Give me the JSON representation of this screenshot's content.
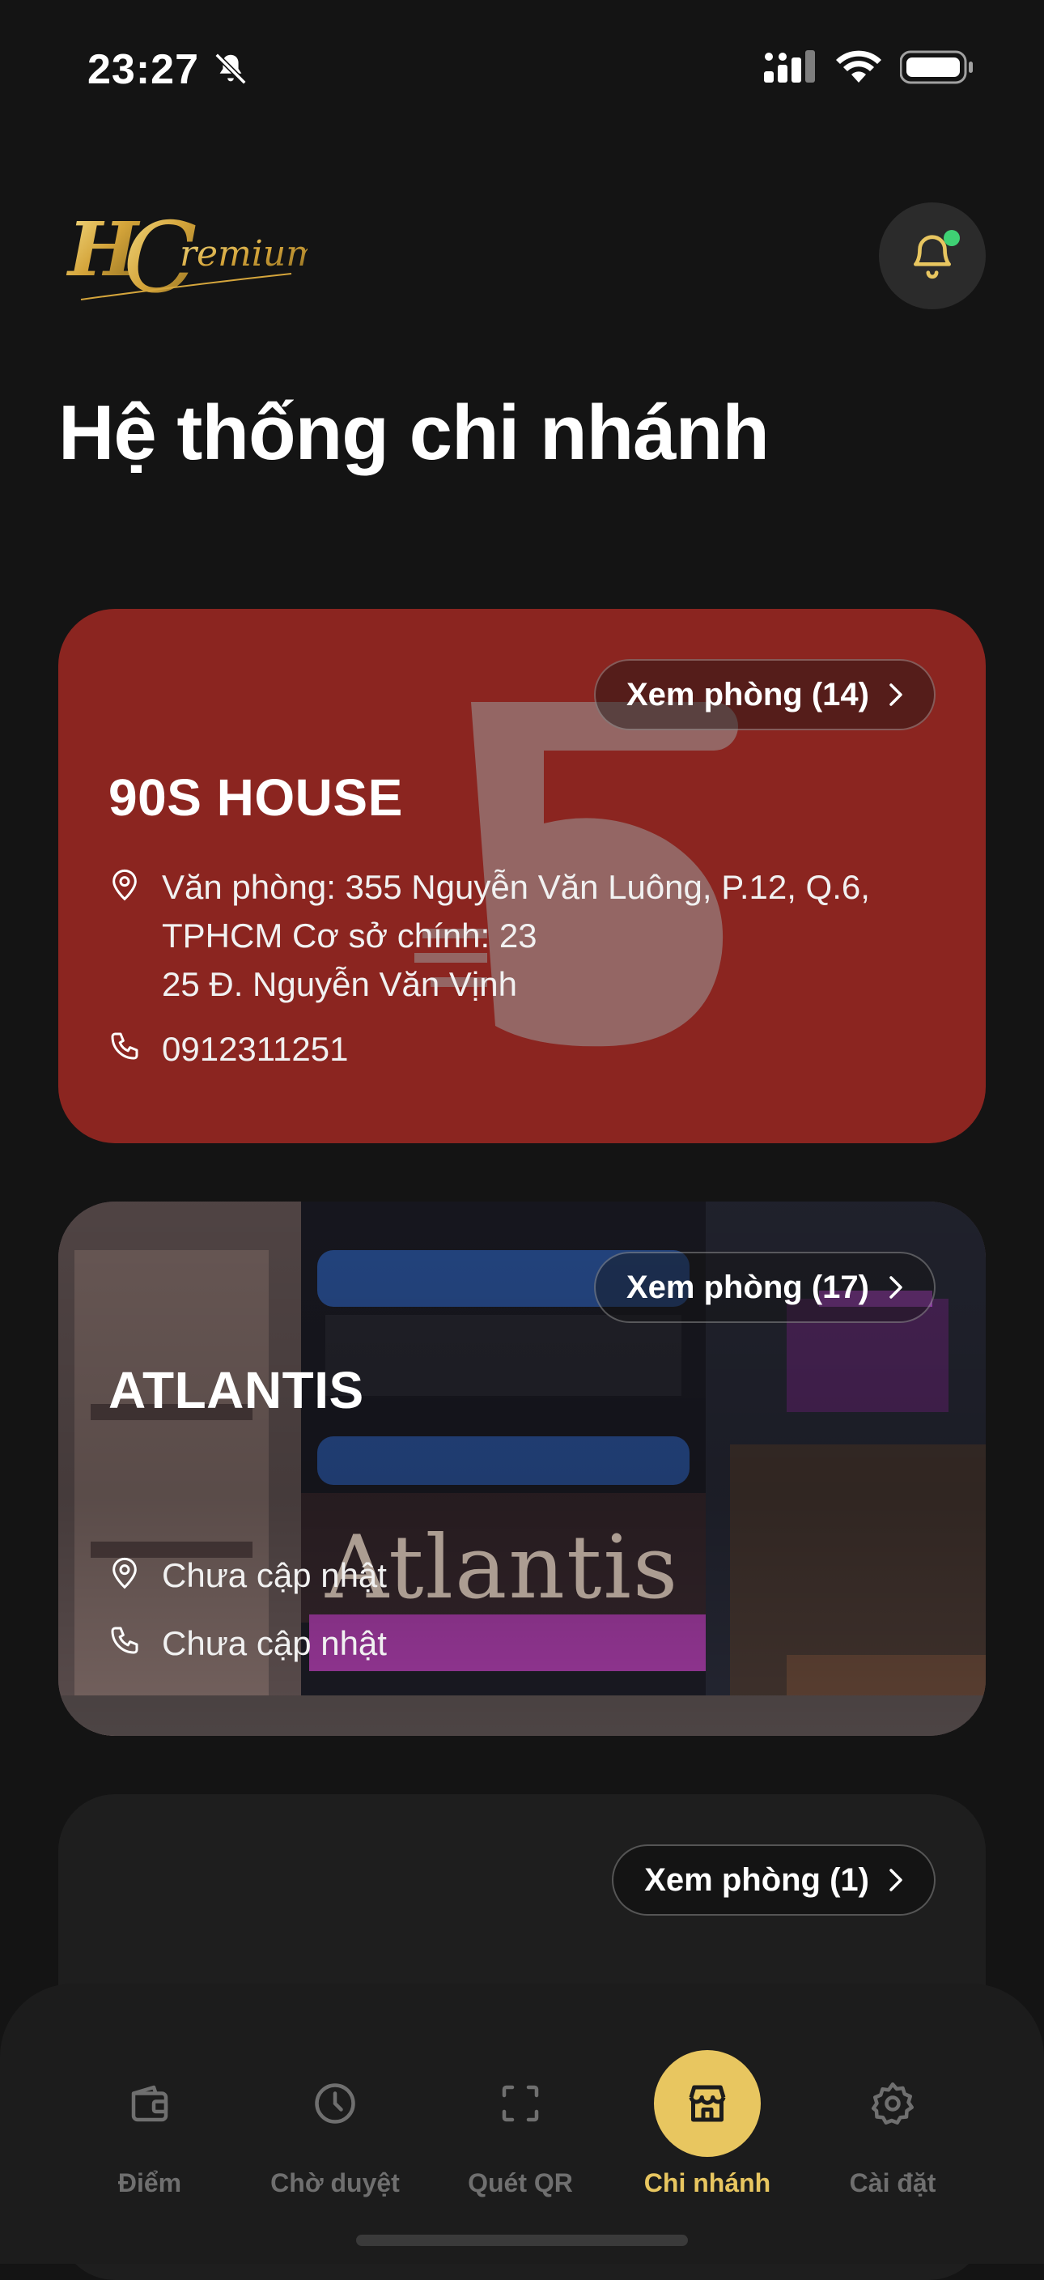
{
  "status_bar": {
    "time": "23:27"
  },
  "header": {
    "logo_text": "HC Premium",
    "title": "Hệ thống chi nhánh"
  },
  "branches": [
    {
      "name": "90S HOUSE",
      "view_rooms_label": "Xem phòng (14)",
      "address": "Văn phòng: 355 Nguyễn Văn Luông, P.12, Q.6,\nTPHCM Cơ sở chính: 23\n25 Đ. Nguyễn Văn Vịnh",
      "phone": "0912311251",
      "card_color": "#8b2520"
    },
    {
      "name": "ATLANTIS",
      "view_rooms_label": "Xem phòng (17)",
      "address": "Chưa cập nhật",
      "phone": "Chưa cập nhật",
      "sign_text": "Atlantis"
    },
    {
      "view_rooms_label": "Xem phòng (1)"
    }
  ],
  "bottom_nav": {
    "items": [
      {
        "label": "Điểm",
        "icon": "wallet-icon"
      },
      {
        "label": "Chờ duyệt",
        "icon": "clock-icon"
      },
      {
        "label": "Quét QR",
        "icon": "scan-icon"
      },
      {
        "label": "Chi nhánh",
        "icon": "store-icon",
        "active": true
      },
      {
        "label": "Cài đặt",
        "icon": "gear-icon"
      }
    ]
  },
  "colors": {
    "background": "#141414",
    "accent": "#e8c660",
    "notification_dot": "#3fd174"
  }
}
